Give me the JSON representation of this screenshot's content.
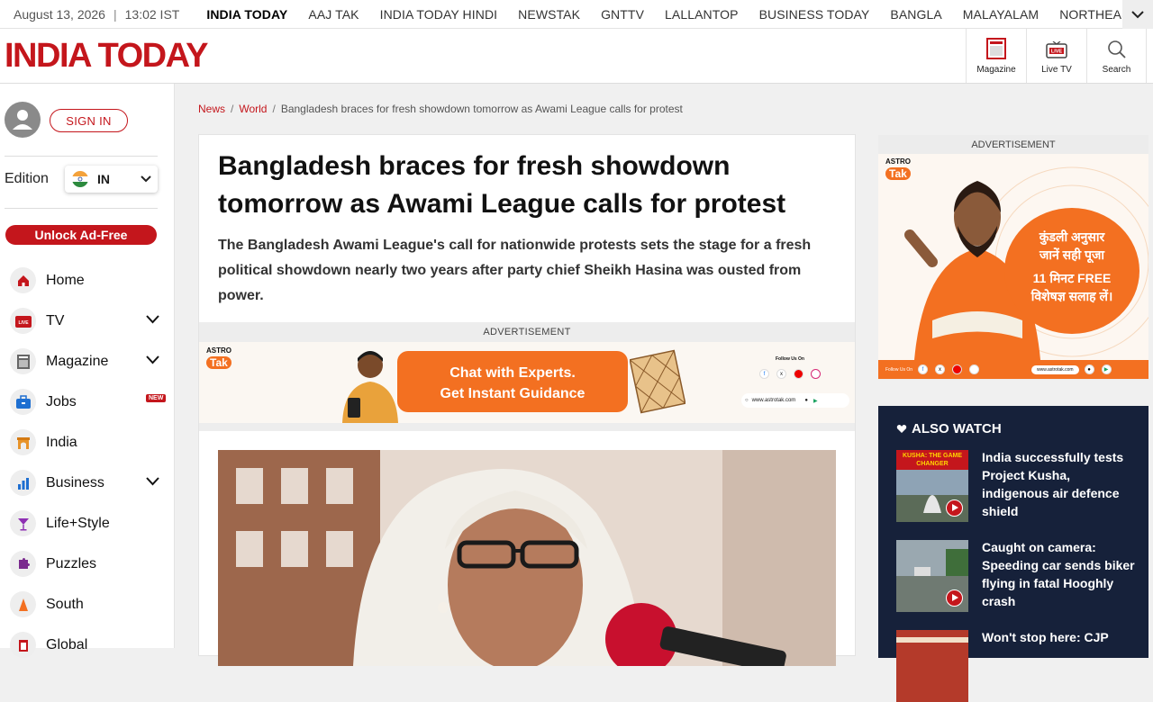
{
  "topstrip": {
    "date": "August 13, 2026",
    "separator": "|",
    "time": "13:02 IST",
    "brands": [
      "INDIA TODAY",
      "AAJ TAK",
      "INDIA TODAY HINDI",
      "NEWSTAK",
      "GNTTV",
      "LALLANTOP",
      "BUSINESS TODAY",
      "BANGLA",
      "MALAYALAM",
      "NORTHEAST"
    ]
  },
  "header": {
    "logo": "INDIA TODAY",
    "magazine_label": "Magazine",
    "livetv_label": "Live TV",
    "livetv_badge": "LIVE",
    "search_label": "Search"
  },
  "sidebar": {
    "signin_label": "SIGN IN",
    "edition_label": "Edition",
    "edition_value": "IN",
    "unlock_label": "Unlock Ad-Free",
    "items": [
      {
        "label": "Home",
        "icon": "home-icon"
      },
      {
        "label": "TV",
        "icon": "live-tv-icon",
        "badge": "LIVE"
      },
      {
        "label": "Magazine",
        "icon": "magazine-icon"
      },
      {
        "label": "Jobs",
        "icon": "briefcase-icon",
        "new": "NEW"
      },
      {
        "label": "India",
        "icon": "india-gate-icon"
      },
      {
        "label": "Business",
        "icon": "bar-chart-icon"
      },
      {
        "label": "Life+Style",
        "icon": "cocktail-icon"
      },
      {
        "label": "Puzzles",
        "icon": "puzzle-icon"
      },
      {
        "label": "South",
        "icon": "temple-icon"
      },
      {
        "label": "Global",
        "icon": "globe-icon"
      }
    ]
  },
  "breadcrumb": {
    "items": [
      "News",
      "World"
    ],
    "separator": "/",
    "current": "Bangladesh braces for fresh showdown tomorrow as Awami League calls for protest"
  },
  "article": {
    "headline": "Bangladesh braces for fresh showdown tomorrow as Awami League calls for protest",
    "summary": "The Bangladesh Awami League's call for nationwide protests sets the stage for a fresh political showdown nearly two years after party chief Sheikh Hasina was ousted from power."
  },
  "ad_inline": {
    "label": "ADVERTISEMENT",
    "brand_top": "ASTRO",
    "brand_bottom": "Tak",
    "cta_line1": "Chat with Experts.",
    "cta_line2": "Get Instant Guidance",
    "follow": "Follow Us On",
    "website": "www.astrotak.com"
  },
  "ad_side": {
    "label": "ADVERTISEMENT",
    "brand_top": "ASTRO",
    "brand_bottom": "Tak",
    "line1": "कुंडली अनुसार",
    "line2": "जानें सही पूजा",
    "line3": "11 मिनट FREE",
    "line4": "विशेषज्ञ सलाह लें।",
    "follow": "Follow Us On",
    "website": "www.astrotak.com"
  },
  "also_watch": {
    "title": "ALSO WATCH",
    "items": [
      {
        "title": "India successfully tests Project Kusha, indigenous air defence shield",
        "thumb_caption": "KUSHA: THE GAME CHANGER"
      },
      {
        "title": "Caught on camera: Speeding car sends biker flying in fatal Hooghly crash"
      },
      {
        "title": "Won't stop here: CJP"
      }
    ]
  },
  "colors": {
    "brand_red": "#c4161c",
    "astro_orange": "#f37021",
    "also_watch_bg": "#16213a"
  }
}
